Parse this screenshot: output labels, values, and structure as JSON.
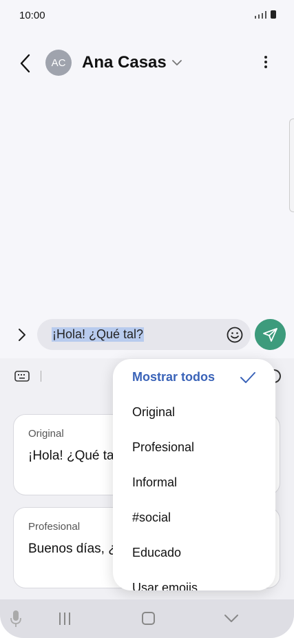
{
  "status_bar": {
    "time": "10:00"
  },
  "header": {
    "avatar_initials": "AC",
    "contact_name": "Ana Casas"
  },
  "composer": {
    "message": "¡Hola! ¿Qué tal?"
  },
  "suggestions": [
    {
      "title": "Original",
      "text": "¡Hola! ¿Qué ta"
    },
    {
      "title": "Profesional",
      "text": "Buenos días, ¿"
    }
  ],
  "tone_menu": {
    "selected": "Mostrar todos",
    "options": [
      "Original",
      "Profesional",
      "Informal",
      "#social",
      "Educado",
      "Usar emojis"
    ]
  },
  "colors": {
    "accent": "#3a63b8",
    "send_button": "#3d9b7c",
    "selection": "#b8cbee"
  }
}
